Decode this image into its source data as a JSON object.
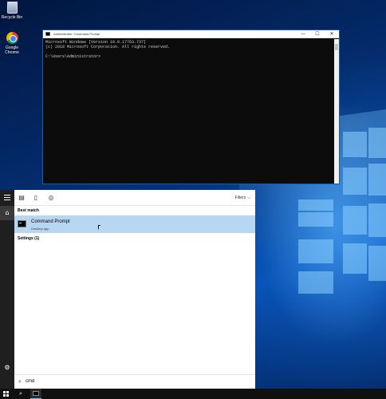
{
  "desktop": {
    "icons": [
      {
        "label": "Recycle Bin",
        "icon": "recycle-bin-icon"
      },
      {
        "label": "Google Chrome",
        "icon": "chrome-icon"
      }
    ]
  },
  "cmd_window": {
    "title": "Administrator: Command Prompt",
    "controls": {
      "minimize": "—",
      "maximize": "☐",
      "close": "✕"
    },
    "lines": [
      "Microsoft Windows [Version 10.0.17763.737]",
      "(c) 2018 Microsoft Corporation. All rights reserved.",
      "",
      "C:\\Users\\Administrator>"
    ]
  },
  "start_menu": {
    "toolbar": {
      "filters_label": "Filters"
    },
    "best_match_heading": "Best match",
    "best_match": {
      "name": "Command Prompt",
      "subtitle": "Desktop app"
    },
    "settings_heading": "Settings (1)",
    "search_query": "cmd"
  },
  "colors": {
    "selected_row": "#b7d6f2",
    "rail": "#1f1f1f",
    "taskbar": "#101010",
    "console_bg": "#0c0c0c",
    "console_text": "#cccccc"
  }
}
